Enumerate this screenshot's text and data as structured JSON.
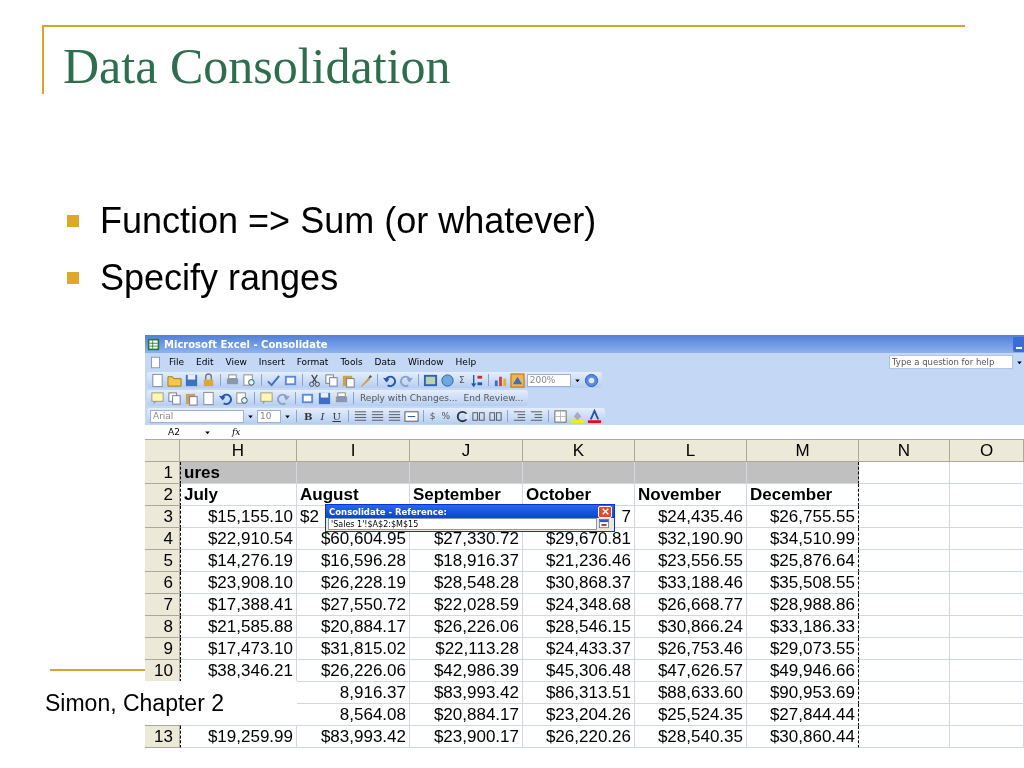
{
  "slide": {
    "title": "Data Consolidation",
    "bullets": [
      "Function => Sum (or whatever)",
      "Specify ranges"
    ],
    "footer": "Simon, Chapter 2"
  },
  "window": {
    "title": "Microsoft Excel - Consolidate"
  },
  "menu": [
    "File",
    "Edit",
    "View",
    "Insert",
    "Format",
    "Tools",
    "Data",
    "Window",
    "Help"
  ],
  "help_box": {
    "placeholder": "Type a question for help"
  },
  "standard_toolbar": {
    "sum_button": "Σ",
    "zoom": "200%"
  },
  "reviewing_toolbar": {
    "buttons": [
      "Reply with Changes...",
      "End Review..."
    ]
  },
  "formatting_toolbar": {
    "font": "Arial",
    "size": "10",
    "style_buttons": [
      "B",
      "I",
      "U"
    ],
    "number_buttons": [
      "$",
      "%"
    ]
  },
  "formula_bar": {
    "name_box": "A2",
    "function_label": "fx"
  },
  "sheet": {
    "columns": [
      "H",
      "I",
      "J",
      "K",
      "L",
      "M",
      "N",
      "O"
    ],
    "rows": [
      {
        "number": "1",
        "kind": "banner",
        "cells": {
          "H": "ures"
        }
      },
      {
        "number": "2",
        "kind": "header",
        "cells": {
          "H": "July",
          "I": "August",
          "J": "September",
          "K": "October",
          "L": "November",
          "M": "December"
        }
      },
      {
        "number": "3",
        "kind": "data",
        "under_dialog": true,
        "cells": {
          "H": "$15,155.10",
          "I": "$2",
          "K": "7",
          "L": "$24,435.46",
          "M": "$26,755.55"
        }
      },
      {
        "number": "4",
        "kind": "data",
        "under_dialog": false,
        "cells": {
          "H": "$22,910.54",
          "I": "$60,604.95",
          "J": "$27,330.72",
          "K": "$29,670.81",
          "L": "$32,190.90",
          "M": "$34,510.99"
        }
      },
      {
        "number": "5",
        "kind": "data",
        "under_dialog": false,
        "cells": {
          "H": "$14,276.19",
          "I": "$16,596.28",
          "J": "$18,916.37",
          "K": "$21,236.46",
          "L": "$23,556.55",
          "M": "$25,876.64"
        }
      },
      {
        "number": "6",
        "kind": "data",
        "under_dialog": false,
        "cells": {
          "H": "$23,908.10",
          "I": "$26,228.19",
          "J": "$28,548.28",
          "K": "$30,868.37",
          "L": "$33,188.46",
          "M": "$35,508.55"
        }
      },
      {
        "number": "7",
        "kind": "data",
        "under_dialog": false,
        "cells": {
          "H": "$17,388.41",
          "I": "$27,550.72",
          "J": "$22,028.59",
          "K": "$24,348.68",
          "L": "$26,668.77",
          "M": "$28,988.86"
        }
      },
      {
        "number": "8",
        "kind": "data",
        "under_dialog": false,
        "cells": {
          "H": "$21,585.88",
          "I": "$20,884.17",
          "J": "$26,226.06",
          "K": "$28,546.15",
          "L": "$30,866.24",
          "M": "$33,186.33"
        }
      },
      {
        "number": "9",
        "kind": "data",
        "under_dialog": false,
        "cells": {
          "H": "$17,473.10",
          "I": "$31,815.02",
          "J": "$22,113.28",
          "K": "$24,433.37",
          "L": "$26,753.46",
          "M": "$29,073.55"
        }
      },
      {
        "number": "10",
        "kind": "data",
        "under_dialog": false,
        "cells": {
          "H": "$38,346.21",
          "I": "$26,226.06",
          "J": "$42,986.39",
          "K": "$45,306.48",
          "L": "$47,626.57",
          "M": "$49,946.66"
        }
      },
      {
        "kind": "data",
        "under_dialog": false,
        "cells": {
          "I": "8,916.37",
          "J": "$83,993.42",
          "K": "$86,313.51",
          "L": "$88,633.60",
          "M": "$90,953.69"
        }
      },
      {
        "kind": "data",
        "under_dialog": false,
        "cells": {
          "I": "8,564.08",
          "J": "$20,884.17",
          "K": "$23,204.26",
          "L": "$25,524.35",
          "M": "$27,844.44"
        }
      },
      {
        "number": "13",
        "kind": "data",
        "under_dialog": false,
        "cells": {
          "H": "$19,259.99",
          "I": "$83,993.42",
          "J": "$23,900.17",
          "K": "$26,220.26",
          "L": "$28,540.35",
          "M": "$30,860.44"
        }
      }
    ]
  },
  "dialog": {
    "title": "Consolidate - Reference:",
    "value": "'Sales 1'!$A$2:$M$15"
  }
}
